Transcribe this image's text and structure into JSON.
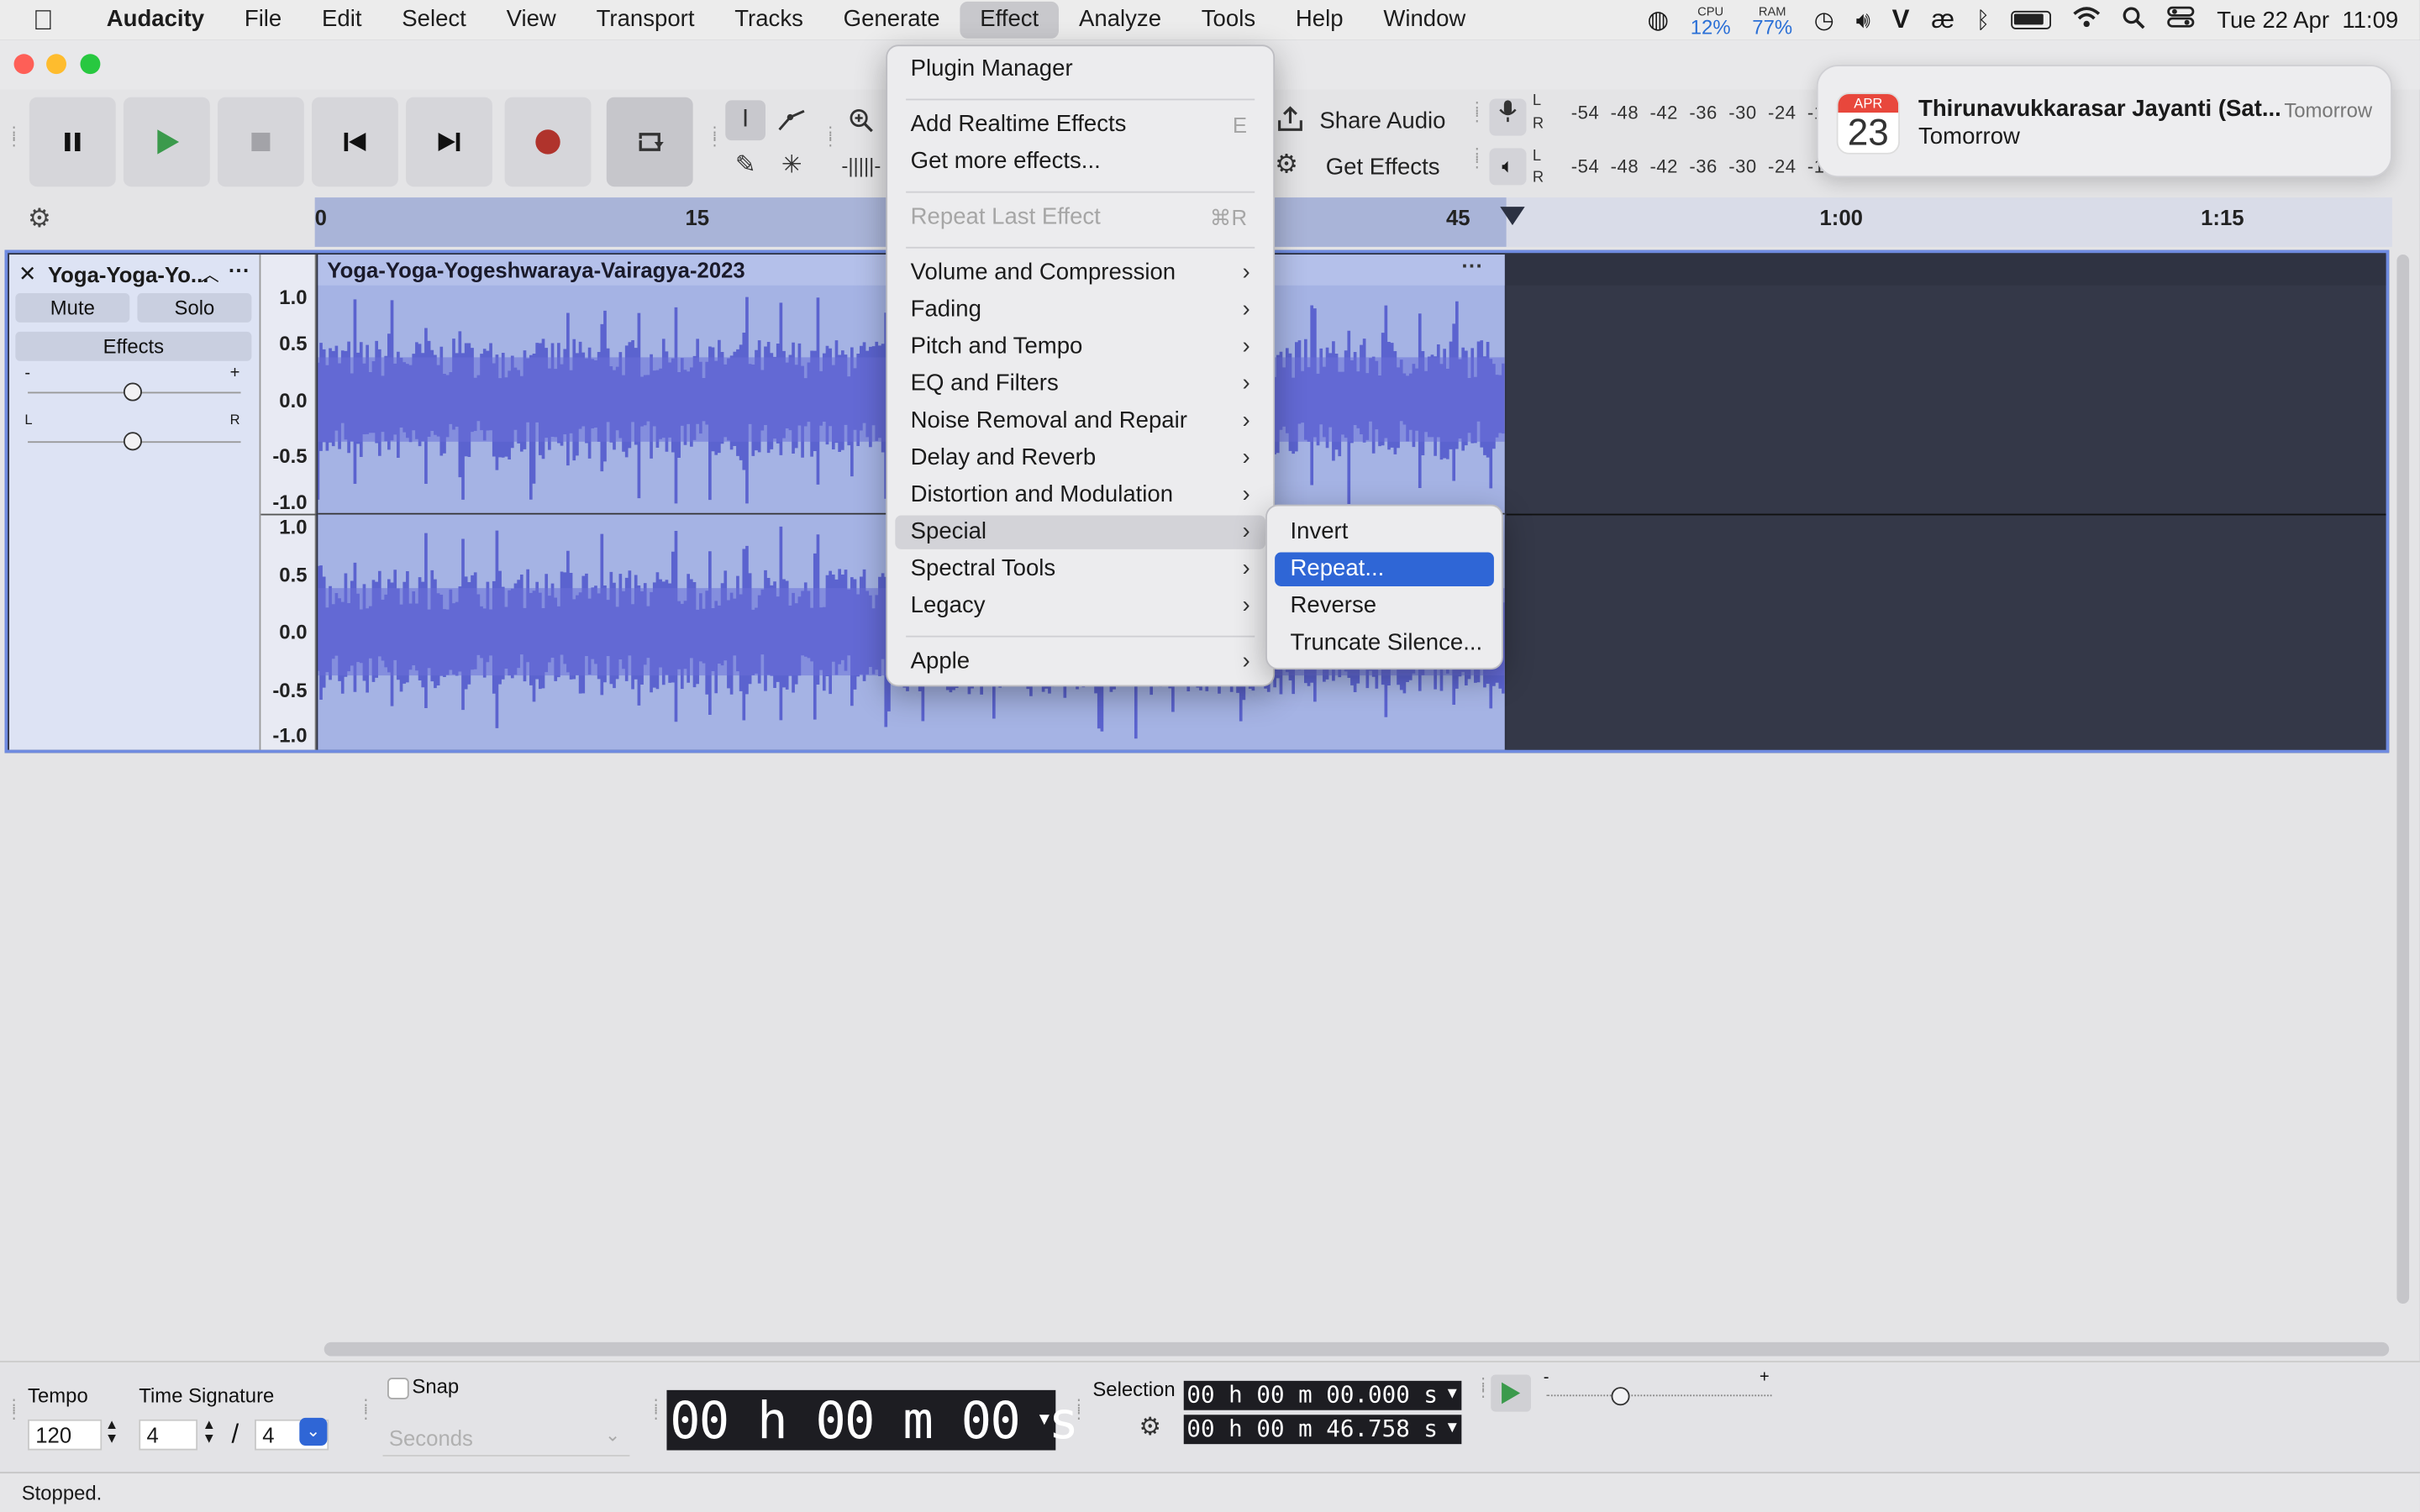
{
  "menubar": {
    "app": "Audacity",
    "items": [
      "File",
      "Edit",
      "Select",
      "View",
      "Transport",
      "Tracks",
      "Generate",
      "Effect",
      "Analyze",
      "Tools",
      "Help",
      "Window"
    ],
    "cpu_label": "CPU",
    "cpu_value": "12%",
    "ram_label": "RAM",
    "ram_value": "77%",
    "v_glyph": "V",
    "ae_glyph": "æ",
    "clock": "Tue 22 Apr  11:09"
  },
  "toolbar": {
    "share_audio": "Share Audio",
    "get_effects": "Get Effects",
    "meter_scale_rec": "-54  -48  -42  -36  -30  -24  -1",
    "meter_scale_play": "-54  -48  -42  -36  -30  -24  -18",
    "l": "L",
    "r": "R"
  },
  "ruler": {
    "ticks": [
      "0",
      "15",
      "45",
      "1:00",
      "1:15"
    ]
  },
  "track": {
    "name": "Yoga-Yoga-Yo...",
    "mute": "Mute",
    "solo": "Solo",
    "effects": "Effects",
    "gain_minus": "-",
    "gain_plus": "+",
    "pan_l": "L",
    "pan_r": "R",
    "clip_name": "Yoga-Yoga-Yogeshwaraya-Vairagya-2023",
    "scale_top": [
      "1.0",
      "0.5",
      "0.0",
      "-0.5",
      "-1.0"
    ],
    "scale_bottom": [
      "1.0",
      "0.5",
      "0.0",
      "-0.5",
      "-1.0"
    ]
  },
  "effect_menu": {
    "items": [
      {
        "label": "Plugin Manager"
      },
      {
        "label": "Add Realtime Effects",
        "shortcut": "E"
      },
      {
        "label": "Get more effects..."
      },
      {
        "label": "Repeat Last Effect",
        "shortcut": "⌘R",
        "disabled": true
      },
      {
        "label": "Volume and Compression",
        "submenu": true
      },
      {
        "label": "Fading",
        "submenu": true
      },
      {
        "label": "Pitch and Tempo",
        "submenu": true
      },
      {
        "label": "EQ and Filters",
        "submenu": true
      },
      {
        "label": "Noise Removal and Repair",
        "submenu": true
      },
      {
        "label": "Delay and Reverb",
        "submenu": true
      },
      {
        "label": "Distortion and Modulation",
        "submenu": true
      },
      {
        "label": "Special",
        "submenu": true,
        "selected": true
      },
      {
        "label": "Spectral Tools",
        "submenu": true
      },
      {
        "label": "Legacy",
        "submenu": true
      },
      {
        "label": "Apple",
        "submenu": true
      }
    ]
  },
  "special_submenu": {
    "items": [
      "Invert",
      "Repeat...",
      "Reverse",
      "Truncate Silence..."
    ],
    "highlighted": "Repeat..."
  },
  "notification": {
    "month": "APR",
    "day": "23",
    "title": "Thirunavukkarasar Jayanti (Sat...",
    "subtitle": "Tomorrow",
    "when": "Tomorrow"
  },
  "bottom": {
    "tempo_label": "Tempo",
    "tempo_value": "120",
    "time_sig_label": "Time Signature",
    "ts_num": "4",
    "ts_slash": "/",
    "ts_den": "4",
    "snap_label": "Snap",
    "snap_unit": "Seconds",
    "time_display": "00 h 00 m 00 s",
    "selection_label": "Selection",
    "sel_start": "00 h 00 m 00.000 s",
    "sel_end": "00 h 00 m 46.758 s",
    "minus": "-",
    "plus": "+"
  },
  "status": "Stopped.",
  "colors": {
    "accent": "#2f66d6",
    "waveform": "#5b63cf",
    "clip": "#a5b3e4",
    "record": "#b0332c"
  }
}
